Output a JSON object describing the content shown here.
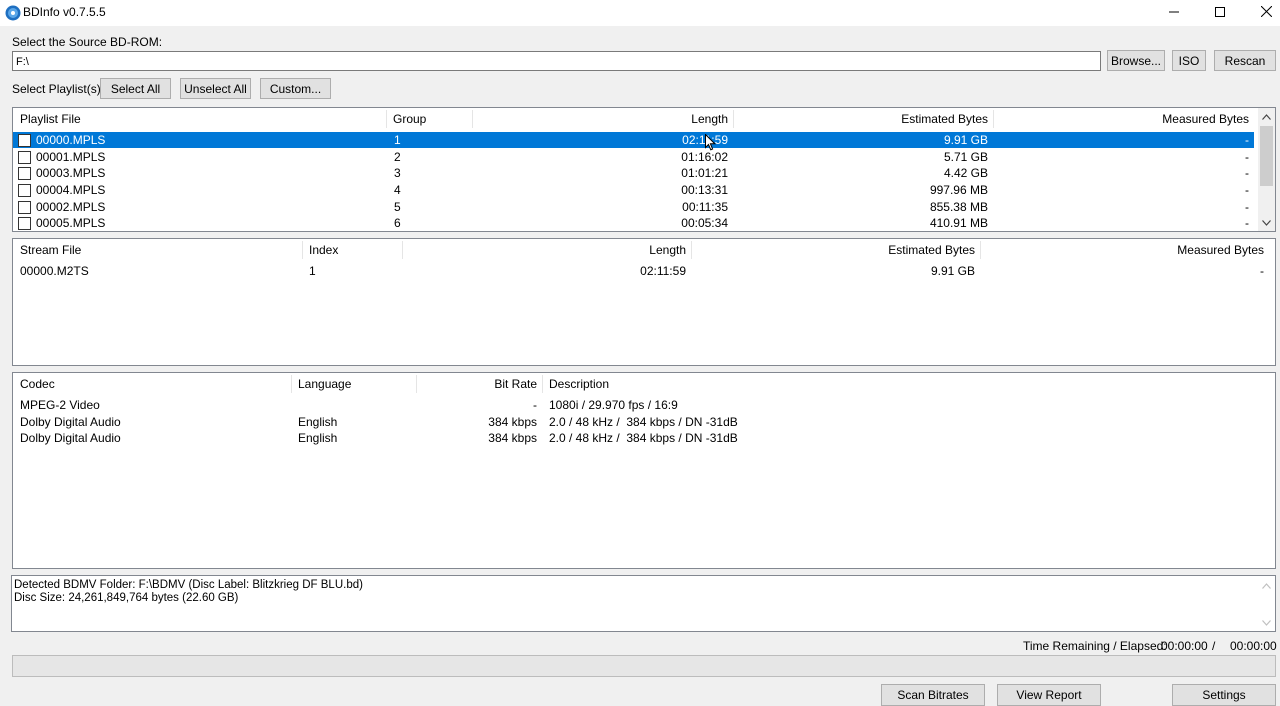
{
  "window": {
    "title": "BDInfo v0.7.5.5"
  },
  "source": {
    "label": "Select the Source BD-ROM:",
    "path": "F:\\",
    "browse": "Browse...",
    "iso": "ISO",
    "rescan": "Rescan"
  },
  "playlist_controls": {
    "label": "Select Playlist(s):",
    "select_all": "Select All",
    "unselect_all": "Unselect All",
    "custom": "Custom..."
  },
  "playlists": {
    "headers": [
      "Playlist File",
      "Group",
      "Length",
      "Estimated Bytes",
      "Measured Bytes"
    ],
    "rows": [
      {
        "file": "00000.MPLS",
        "group": "1",
        "length": "02:11:59",
        "estimated": "9.91 GB",
        "measured": "-",
        "checked": false,
        "selected": true
      },
      {
        "file": "00001.MPLS",
        "group": "2",
        "length": "01:16:02",
        "estimated": "5.71 GB",
        "measured": "-",
        "checked": false,
        "selected": false
      },
      {
        "file": "00003.MPLS",
        "group": "3",
        "length": "01:01:21",
        "estimated": "4.42 GB",
        "measured": "-",
        "checked": false,
        "selected": false
      },
      {
        "file": "00004.MPLS",
        "group": "4",
        "length": "00:13:31",
        "estimated": "997.96 MB",
        "measured": "-",
        "checked": false,
        "selected": false
      },
      {
        "file": "00002.MPLS",
        "group": "5",
        "length": "00:11:35",
        "estimated": "855.38 MB",
        "measured": "-",
        "checked": false,
        "selected": false
      },
      {
        "file": "00005.MPLS",
        "group": "6",
        "length": "00:05:34",
        "estimated": "410.91 MB",
        "measured": "-",
        "checked": false,
        "selected": false
      }
    ]
  },
  "streams": {
    "headers": [
      "Stream File",
      "Index",
      "Length",
      "Estimated Bytes",
      "Measured Bytes"
    ],
    "rows": [
      {
        "file": "00000.M2TS",
        "index": "1",
        "length": "02:11:59",
        "estimated": "9.91 GB",
        "measured": "-"
      }
    ]
  },
  "codecs": {
    "headers": [
      "Codec",
      "Language",
      "Bit Rate",
      "Description"
    ],
    "rows": [
      {
        "codec": "MPEG-2 Video",
        "language": "",
        "bitrate": "-",
        "description": "1080i / 29.970 fps / 16:9"
      },
      {
        "codec": "Dolby Digital Audio",
        "language": "English",
        "bitrate": "384 kbps",
        "description": "2.0 / 48 kHz /  384 kbps / DN -31dB"
      },
      {
        "codec": "Dolby Digital Audio",
        "language": "English",
        "bitrate": "384 kbps",
        "description": "2.0 / 48 kHz /  384 kbps / DN -31dB"
      }
    ]
  },
  "log": {
    "lines": [
      "Detected BDMV Folder: F:\\BDMV (Disc Label: Blitzkrieg DF BLU.bd)",
      "Disc Size: 24,261,849,764 bytes (22.60 GB)"
    ]
  },
  "status": {
    "time_label": "Time Remaining / Elapsed:",
    "remaining": "00:00:00",
    "separator": "/",
    "elapsed": "00:00:00",
    "progress": 0
  },
  "footer": {
    "scan_bitrates": "Scan Bitrates",
    "view_report": "View Report",
    "settings": "Settings"
  },
  "colors": {
    "selection": "#0078d7",
    "window_bg": "#f0f0f0"
  }
}
